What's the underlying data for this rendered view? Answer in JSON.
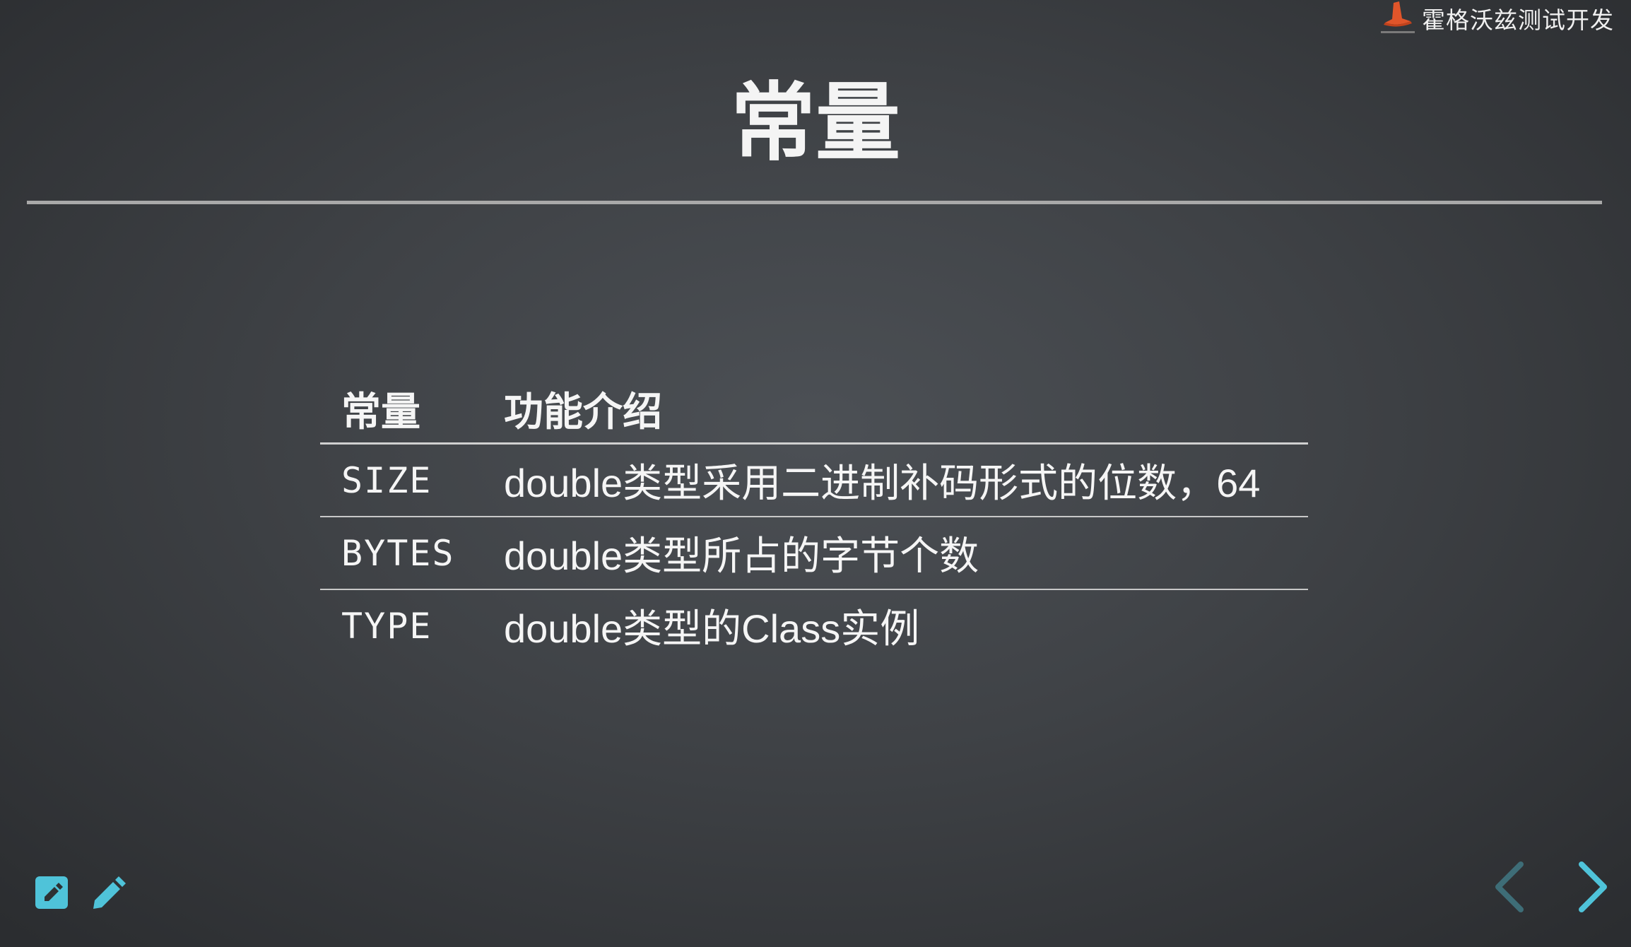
{
  "brand": {
    "text": "霍格沃兹测试开发",
    "logo_icon": "wizard-hat-icon",
    "accent_color": "#e0552a"
  },
  "slide": {
    "title": "常量"
  },
  "table": {
    "headers": [
      "常量",
      "功能介绍"
    ],
    "rows": [
      {
        "name": "SIZE",
        "description": "double类型采用二进制补码形式的位数，64"
      },
      {
        "name": "BYTES",
        "description": "double类型所占的字节个数"
      },
      {
        "name": "TYPE",
        "description": "double类型的Class实例"
      }
    ]
  },
  "controls": {
    "edit_icon": "edit-box-icon",
    "pencil_icon": "pencil-icon",
    "prev_icon": "chevron-left-icon",
    "next_icon": "chevron-right-icon",
    "accent_color": "#4fc3d9",
    "disabled_color": "#3e6d77"
  }
}
